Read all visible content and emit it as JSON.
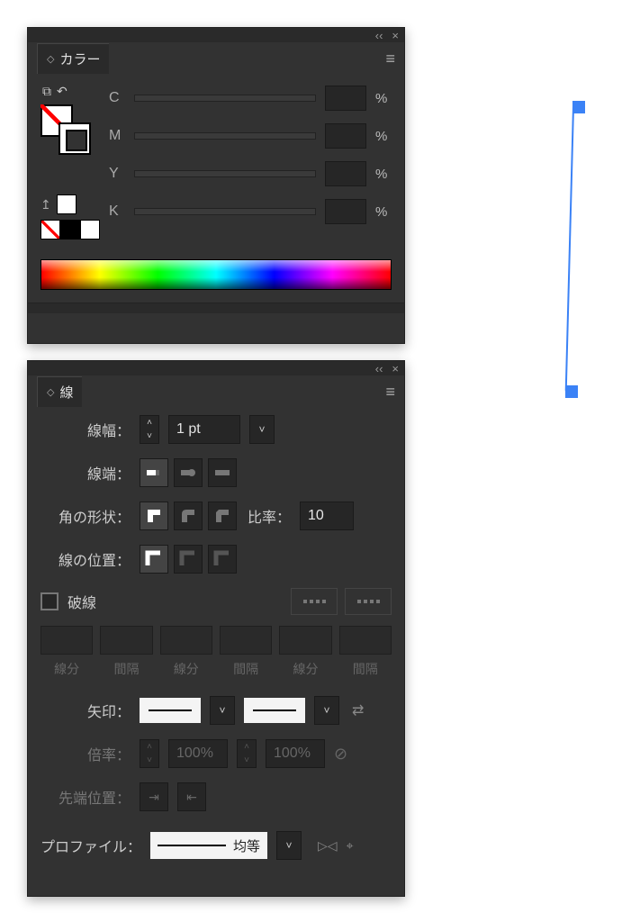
{
  "colorPanel": {
    "title": "カラー",
    "channels": [
      {
        "label": "C",
        "value": "",
        "unit": "%"
      },
      {
        "label": "M",
        "value": "",
        "unit": "%"
      },
      {
        "label": "Y",
        "value": "",
        "unit": "%"
      },
      {
        "label": "K",
        "value": "",
        "unit": "%"
      }
    ]
  },
  "strokePanel": {
    "title": "線",
    "weightLabel": "線幅：",
    "weightValue": "1 pt",
    "capLabel": "線端：",
    "cornerLabel": "角の形状：",
    "miterLabel": "比率：",
    "miterValue": "10",
    "alignLabel": "線の位置：",
    "dashLabel": "破線",
    "dashCols": [
      "線分",
      "間隔",
      "線分",
      "間隔",
      "線分",
      "間隔"
    ],
    "arrowLabel": "矢印：",
    "scaleLabel": "倍率：",
    "scaleValue1": "100%",
    "scaleValue2": "100%",
    "tipPosLabel": "先端位置：",
    "profileLabel": "プロファイル：",
    "profileValue": "均等"
  }
}
